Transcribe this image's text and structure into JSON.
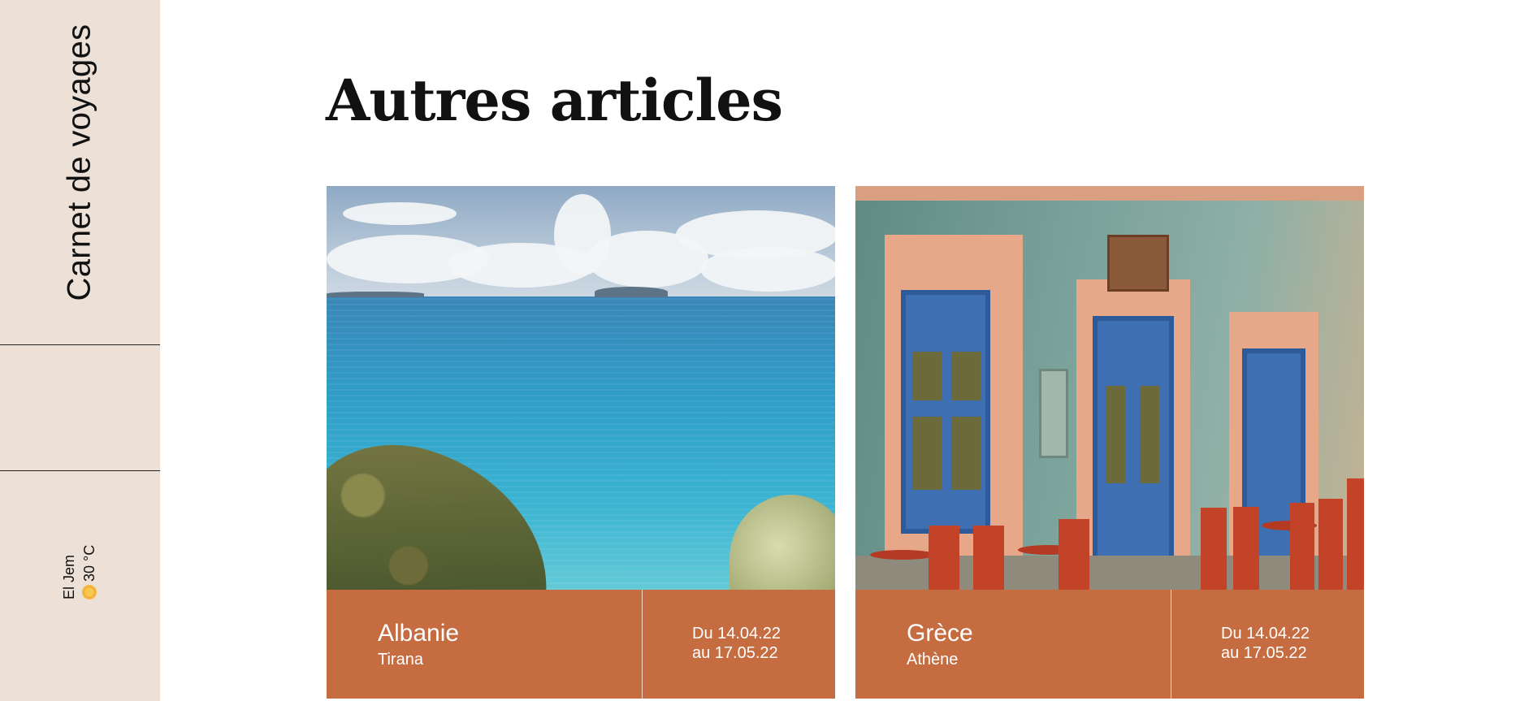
{
  "sidebar": {
    "brand": "Carnet de voyages",
    "weather": {
      "city": "El Jem",
      "icon": "sun-icon",
      "temperature": "30 °C"
    }
  },
  "main": {
    "title": "Autres articles",
    "articles": [
      {
        "image": "albania-coast-image",
        "country": "Albanie",
        "city": "Tirana",
        "date_from": "Du 14.04.22",
        "date_to": "au 17.05.22"
      },
      {
        "image": "greece-cafe-image",
        "country": "Grèce",
        "city": "Athène",
        "date_from": "Du 14.04.22",
        "date_to": "au 17.05.22"
      }
    ]
  },
  "colors": {
    "sidebar_bg": "#ece0d7",
    "card_footer": "#c66c41",
    "text": "#111111"
  }
}
